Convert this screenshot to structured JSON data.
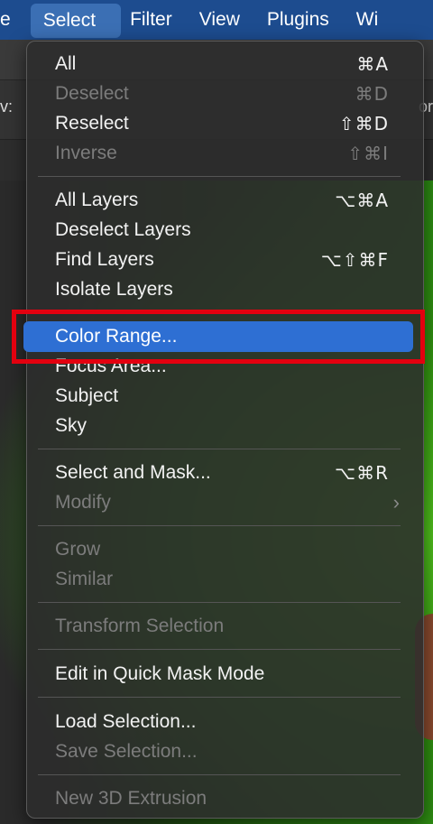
{
  "menubar": {
    "items": [
      "e",
      "Select",
      "Filter",
      "View",
      "Plugins",
      "Wi"
    ],
    "active": "Select"
  },
  "background": {
    "fragment_left": "v:",
    "fragment_right": "or"
  },
  "menu": {
    "items": [
      {
        "label": "All",
        "shortcut": "⌘A",
        "disabled": false
      },
      {
        "label": "Deselect",
        "shortcut": "⌘D",
        "disabled": true
      },
      {
        "label": "Reselect",
        "shortcut": "⇧⌘D",
        "disabled": false
      },
      {
        "label": "Inverse",
        "shortcut": "⇧⌘I",
        "disabled": true
      },
      {
        "label": "All Layers",
        "shortcut": "⌥⌘A",
        "disabled": false
      },
      {
        "label": "Deselect Layers",
        "shortcut": "",
        "disabled": false
      },
      {
        "label": "Find Layers",
        "shortcut": "⌥⇧⌘F",
        "disabled": false
      },
      {
        "label": "Isolate Layers",
        "shortcut": "",
        "disabled": false
      },
      {
        "label": "Color Range...",
        "shortcut": "",
        "disabled": false,
        "highlighted": true
      },
      {
        "label": "Focus Area...",
        "shortcut": "",
        "disabled": false
      },
      {
        "label": "Subject",
        "shortcut": "",
        "disabled": false
      },
      {
        "label": "Sky",
        "shortcut": "",
        "disabled": false
      },
      {
        "label": "Select and Mask...",
        "shortcut": "⌥⌘R",
        "disabled": false
      },
      {
        "label": "Modify",
        "shortcut": "",
        "disabled": true,
        "submenu": true
      },
      {
        "label": "Grow",
        "shortcut": "",
        "disabled": true
      },
      {
        "label": "Similar",
        "shortcut": "",
        "disabled": true
      },
      {
        "label": "Transform Selection",
        "shortcut": "",
        "disabled": true
      },
      {
        "label": "Edit in Quick Mask Mode",
        "shortcut": "",
        "disabled": false
      },
      {
        "label": "Load Selection...",
        "shortcut": "",
        "disabled": false
      },
      {
        "label": "Save Selection...",
        "shortcut": "",
        "disabled": true
      },
      {
        "label": "New 3D Extrusion",
        "shortcut": "",
        "disabled": true
      }
    ],
    "submenu_arrow": "›"
  },
  "colors": {
    "menubar": "#1d4c8f",
    "highlight": "#2e6fd3",
    "callout": "#e3000f"
  }
}
